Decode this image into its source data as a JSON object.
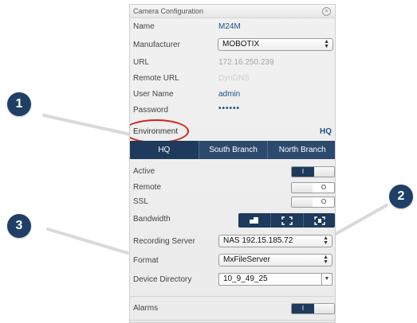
{
  "panel": {
    "title": "Camera Configuration",
    "close_glyph": "×"
  },
  "fields": {
    "name_label": "Name",
    "name_value": "M24M",
    "manufacturer_label": "Manufacturer",
    "manufacturer_value": "MOBOTIX",
    "url_label": "URL",
    "url_value": "172.16.250.239",
    "remote_url_label": "Remote URL",
    "remote_url_value": "DynDNS",
    "user_name_label": "User Name",
    "user_name_value": "admin",
    "password_label": "Password",
    "password_value": "••••••"
  },
  "environment": {
    "label": "Environment",
    "current": "HQ",
    "tabs": [
      "HQ",
      "South Branch",
      "North Branch"
    ]
  },
  "toggles": {
    "active_label": "Active",
    "active_on_text": "I",
    "remote_label": "Remote",
    "remote_off_text": "O",
    "ssl_label": "SSL",
    "ssl_off_text": "O"
  },
  "bandwidth": {
    "label": "Bandwidth",
    "icons": [
      "bandwidth-low-icon",
      "bandwidth-medium-icon",
      "bandwidth-high-icon"
    ]
  },
  "recording": {
    "server_label": "Recording Server",
    "server_value": "NAS 192.15.185.72",
    "format_label": "Format",
    "format_value": "MxFileServer",
    "directory_label": "Device Directory",
    "directory_value": "10_9_49_25"
  },
  "alarms": {
    "label": "Alarms",
    "on_text": "I"
  },
  "callouts": [
    "1",
    "2",
    "3"
  ],
  "colors": {
    "accent": "#1e3a5c",
    "link": "#1d4f8a",
    "highlight": "#d0231a"
  }
}
